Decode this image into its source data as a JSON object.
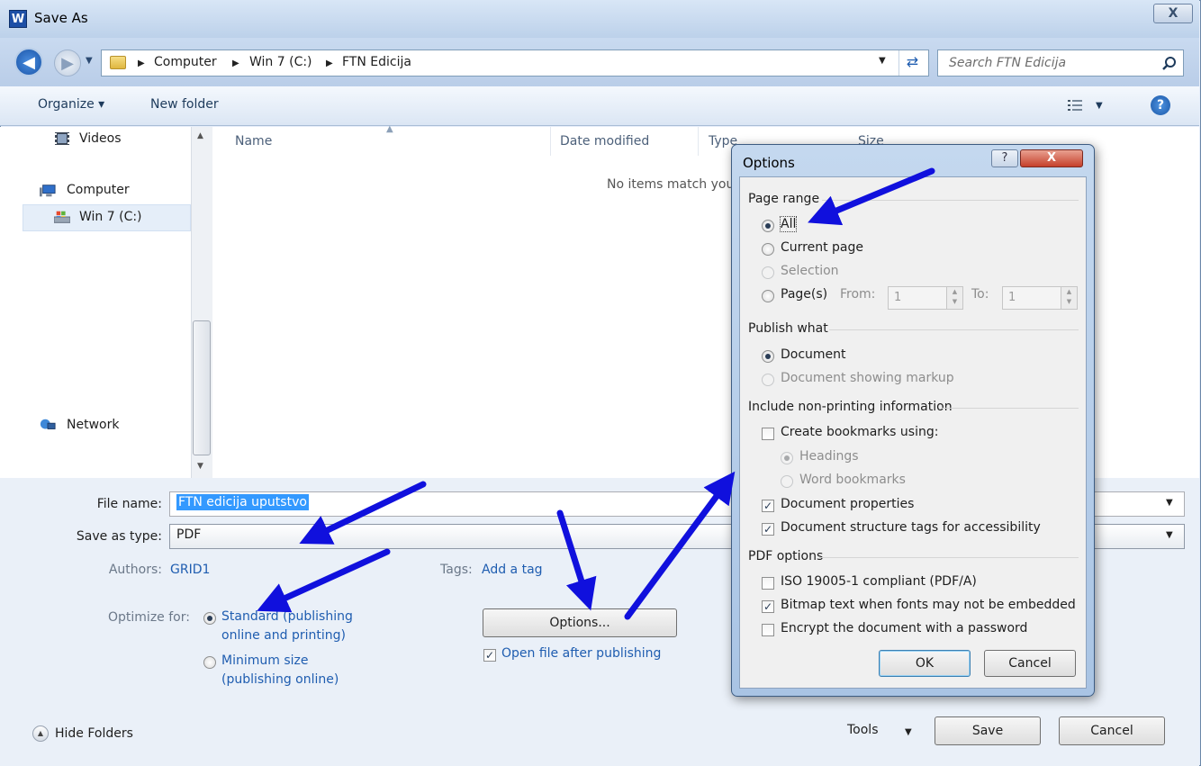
{
  "window": {
    "title": "Save As",
    "app_icon": "W",
    "close_glyph": "X"
  },
  "address": {
    "crumbs": [
      "Computer",
      "Win 7 (C:)",
      "FTN Edicija"
    ],
    "search_placeholder": "Search FTN Edicija"
  },
  "toolbar": {
    "organize": "Organize ▾",
    "new_folder": "New folder"
  },
  "nav": {
    "videos": "Videos",
    "computer": "Computer",
    "win7": "Win 7 (C:)",
    "network": "Network"
  },
  "file_list": {
    "columns": [
      "Name",
      "Date modified",
      "Type",
      "Size"
    ],
    "empty_message": "No items match your search."
  },
  "form": {
    "file_name_label": "File name:",
    "file_name_value": "FTN edicija uputstvo",
    "save_type_label": "Save as type:",
    "save_type_value": "PDF",
    "authors_label": "Authors:",
    "authors_value": "GRID1",
    "tags_label": "Tags:",
    "tags_value": "Add a tag",
    "optimize_label": "Optimize for:",
    "optimize_standard_1": "Standard (publishing",
    "optimize_standard_2": "online and printing)",
    "optimize_minimum_1": "Minimum size",
    "optimize_minimum_2": "(publishing online)",
    "options_button": "Options...",
    "open_after": "Open file after publishing",
    "hide_folders": "Hide Folders",
    "tools": "Tools",
    "save": "Save",
    "cancel": "Cancel"
  },
  "options_dialog": {
    "title": "Options",
    "help_glyph": "?",
    "close_glyph": "X",
    "page_range_head": "Page range",
    "all": "All",
    "current_page": "Current page",
    "selection": "Selection",
    "pages": "Page(s)",
    "from_label": "From:",
    "from_value": "1",
    "to_label": "To:",
    "to_value": "1",
    "publish_head": "Publish what",
    "document": "Document",
    "document_markup": "Document showing markup",
    "nonprinting_head": "Include non-printing information",
    "create_bookmarks": "Create bookmarks using:",
    "headings": "Headings",
    "word_bookmarks": "Word bookmarks",
    "doc_properties": "Document properties",
    "doc_structure": "Document structure tags for accessibility",
    "pdf_head": "PDF options",
    "iso": "ISO 19005-1 compliant (PDF/A)",
    "bitmap": "Bitmap text when fonts may not be embedded",
    "encrypt": "Encrypt the document with a password",
    "ok": "OK",
    "cancel": "Cancel"
  },
  "colors": {
    "accent_link": "#1f5db0",
    "selection": "#3399ff",
    "annotation_arrow": "#1010dd"
  }
}
